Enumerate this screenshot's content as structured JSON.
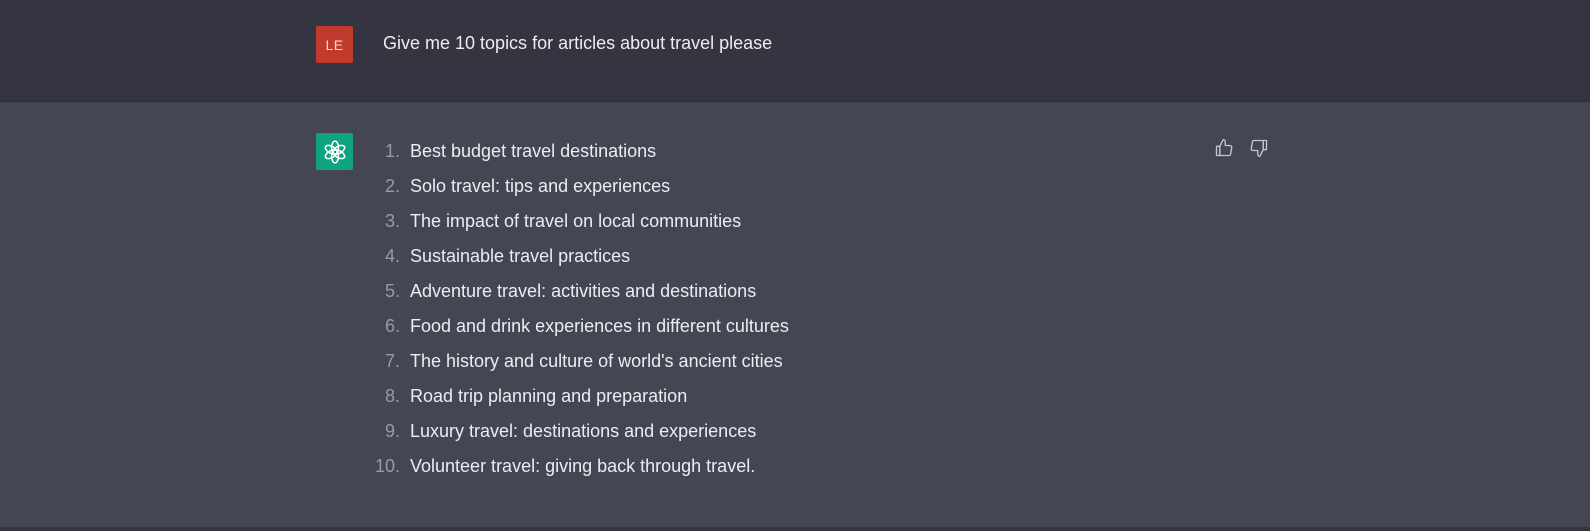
{
  "user_message": {
    "avatar_initials": "LE",
    "text": "Give me 10 topics for articles about travel please"
  },
  "assistant_message": {
    "avatar_icon": "openai-logo-icon",
    "items": [
      {
        "number": "1.",
        "text": "Best budget travel destinations"
      },
      {
        "number": "2.",
        "text": "Solo travel: tips and experiences"
      },
      {
        "number": "3.",
        "text": "The impact of travel on local communities"
      },
      {
        "number": "4.",
        "text": "Sustainable travel practices"
      },
      {
        "number": "5.",
        "text": "Adventure travel: activities and destinations"
      },
      {
        "number": "6.",
        "text": "Food and drink experiences in different cultures"
      },
      {
        "number": "7.",
        "text": "The history and culture of world's ancient cities"
      },
      {
        "number": "8.",
        "text": "Road trip planning and preparation"
      },
      {
        "number": "9.",
        "text": "Luxury travel: destinations and experiences"
      },
      {
        "number": "10.",
        "text": "Volunteer travel: giving back through travel."
      }
    ]
  },
  "feedback": {
    "thumbs_up_icon": "thumbs-up-icon",
    "thumbs_down_icon": "thumbs-down-icon"
  },
  "colors": {
    "user_row_bg": "#343541",
    "assistant_row_bg": "#444654",
    "user_avatar_bg": "#c13b2d",
    "bot_avatar_bg": "#10a37f",
    "text": "#ececf1",
    "list_number": "#9a9aa6"
  }
}
